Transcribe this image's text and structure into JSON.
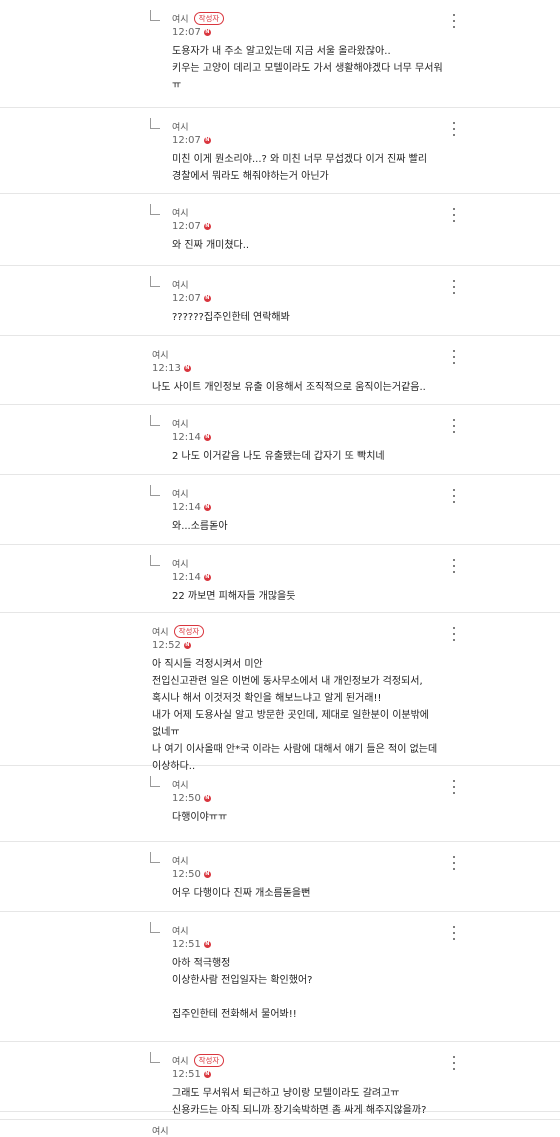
{
  "comments": [
    {
      "type": "reply",
      "nickname": "여시",
      "badge": "작성자",
      "time": "12:07",
      "new": true,
      "text": "도용자가 내 주소 알고있는데 지금 서울 올라왔잖아..\n키우는 고양이 데리고 모텔이라도 가서 생활해야겠다 너무 무서워\nㅠ"
    },
    {
      "type": "reply",
      "nickname": "여시",
      "badge": "",
      "time": "12:07",
      "new": true,
      "text": "미친 이게 뭔소리야...? 와 미친 너무 무섭겠다 이거 진짜 빨리\n경찰에서 뭐라도 해줘야하는거 아닌가"
    },
    {
      "type": "reply",
      "nickname": "여시",
      "badge": "",
      "time": "12:07",
      "new": true,
      "text": "와 진짜 개미쳤다.."
    },
    {
      "type": "reply",
      "nickname": "여시",
      "badge": "",
      "time": "12:07",
      "new": true,
      "text": "??????집주인한테 연락해봐"
    },
    {
      "type": "root",
      "nickname": "여시",
      "badge": "",
      "time": "12:13",
      "new": true,
      "text": "나도 사이트 개인정보 유출 이용해서 조직적으로 움직이는거같음.."
    },
    {
      "type": "reply",
      "nickname": "여시",
      "badge": "",
      "time": "12:14",
      "new": true,
      "text": "2 나도 이거같음 나도 유출됐는데 갑자기 또 빡치네"
    },
    {
      "type": "reply",
      "nickname": "여시",
      "badge": "",
      "time": "12:14",
      "new": true,
      "text": "와...소름돋아"
    },
    {
      "type": "reply",
      "nickname": "여시",
      "badge": "",
      "time": "12:14",
      "new": true,
      "text": "22 까보면 피해자들 개많을듯"
    },
    {
      "type": "root",
      "nickname": "여시",
      "badge": "작성자",
      "time": "12:52",
      "new": true,
      "text": "아 직시들 걱정시켜서 미안\n전입신고관련 일은 이번에 동사무소에서 내 개인정보가 걱정되서,\n혹시나 해서 이것저것 확인을 해보느냐고 알게 된거래!!\n내가 어제 도용사실 알고 방문한 곳인데, 제대로 일한분이 이분밖에\n없네ㅠ\n나 여기 이사올때 안*국 이라는 사람에 대해서 얘기 들은 적이 없는데\n이상하다.."
    },
    {
      "type": "reply",
      "nickname": "여시",
      "badge": "",
      "time": "12:50",
      "new": true,
      "text": "다행이야ㅠㅠ"
    },
    {
      "type": "reply",
      "nickname": "여시",
      "badge": "",
      "time": "12:50",
      "new": true,
      "text": "어우 다행이다 진짜 개소름돋을뻔"
    },
    {
      "type": "reply",
      "nickname": "여시",
      "badge": "",
      "time": "12:51",
      "new": true,
      "text": "아하 적극행정\n이상한사람 전입일자는 확인했어?\n\n집주인한테 전화해서 물어봐!!"
    },
    {
      "type": "reply",
      "nickname": "여시",
      "badge": "작성자",
      "time": "12:51",
      "new": true,
      "text": "그래도 무서워서 퇴근하고 냥이랑 모텔이라도 갈려고ㅠ\n신용카드는 아직 되니까 장기숙박하면 좀 싸게 해주지않을까?"
    },
    {
      "type": "root",
      "nickname": "여시",
      "badge": "",
      "time": "",
      "new": false,
      "text": ""
    }
  ]
}
